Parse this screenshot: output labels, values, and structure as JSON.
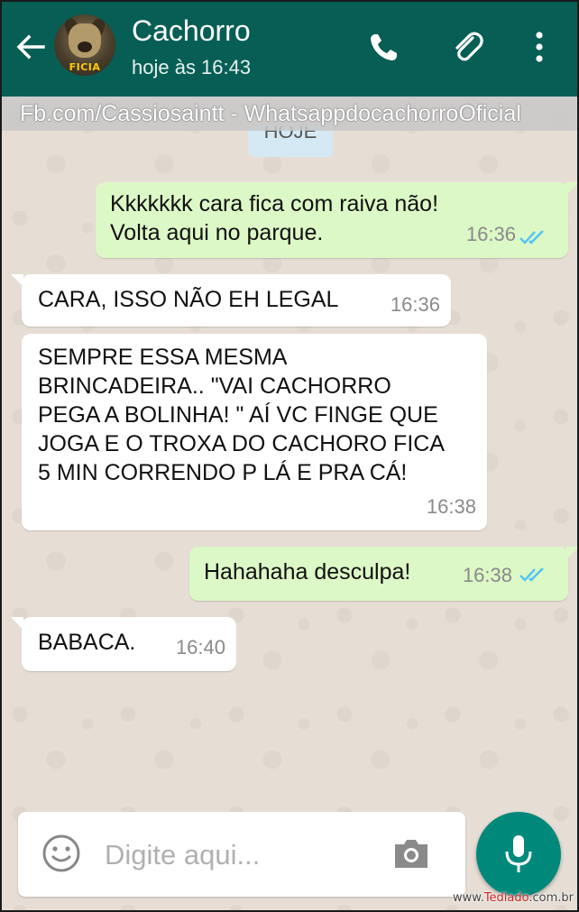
{
  "header": {
    "contact_name": "Cachorro",
    "last_seen": "hoje às 16:43",
    "avatar_badge": "FICIA",
    "icons": [
      "back-arrow-icon",
      "phone-icon",
      "paperclip-icon",
      "more-vert-icon"
    ]
  },
  "watermark": "Fb.com/Cassiosaintt -  WhatsappdocachorroOficial",
  "date_chip": "HOJE",
  "messages": [
    {
      "direction": "out",
      "lines": [
        "Kkkkkkk cara fica com raiva não!",
        "Volta aqui no parque."
      ],
      "time": "16:36",
      "status": "read"
    },
    {
      "direction": "in",
      "lines": [
        "CARA,  ISSO NÃO EH LEGAL"
      ],
      "time": "16:36"
    },
    {
      "direction": "in",
      "lines": [
        "SEMPRE ESSA MESMA",
        "BRINCADEIRA..  \"VAI CACHORRO",
        "PEGA A BOLINHA! \"  AÍ VC FINGE QUE",
        "JOGA E O TROXA DO CACHORO FICA",
        "5 MIN CORRENDO P LÁ E PRA CÁ!"
      ],
      "time": "16:38"
    },
    {
      "direction": "out",
      "lines": [
        "Hahahaha desculpa!"
      ],
      "time": "16:38",
      "status": "read"
    },
    {
      "direction": "in",
      "lines": [
        "BABACA."
      ],
      "time": "16:40"
    }
  ],
  "composer": {
    "placeholder": "Digite aqui...",
    "icons": [
      "emoji-icon",
      "camera-icon",
      "mic-icon"
    ]
  },
  "site_mark": {
    "prefix": "www.",
    "name": "Tediado",
    "suffix": ".com.br"
  },
  "colors": {
    "header": "#075e54",
    "outgoing_bubble": "#dcf8c6",
    "incoming_bubble": "#ffffff",
    "read_ticks": "#4fc3f7",
    "mic_button": "#00897b"
  }
}
